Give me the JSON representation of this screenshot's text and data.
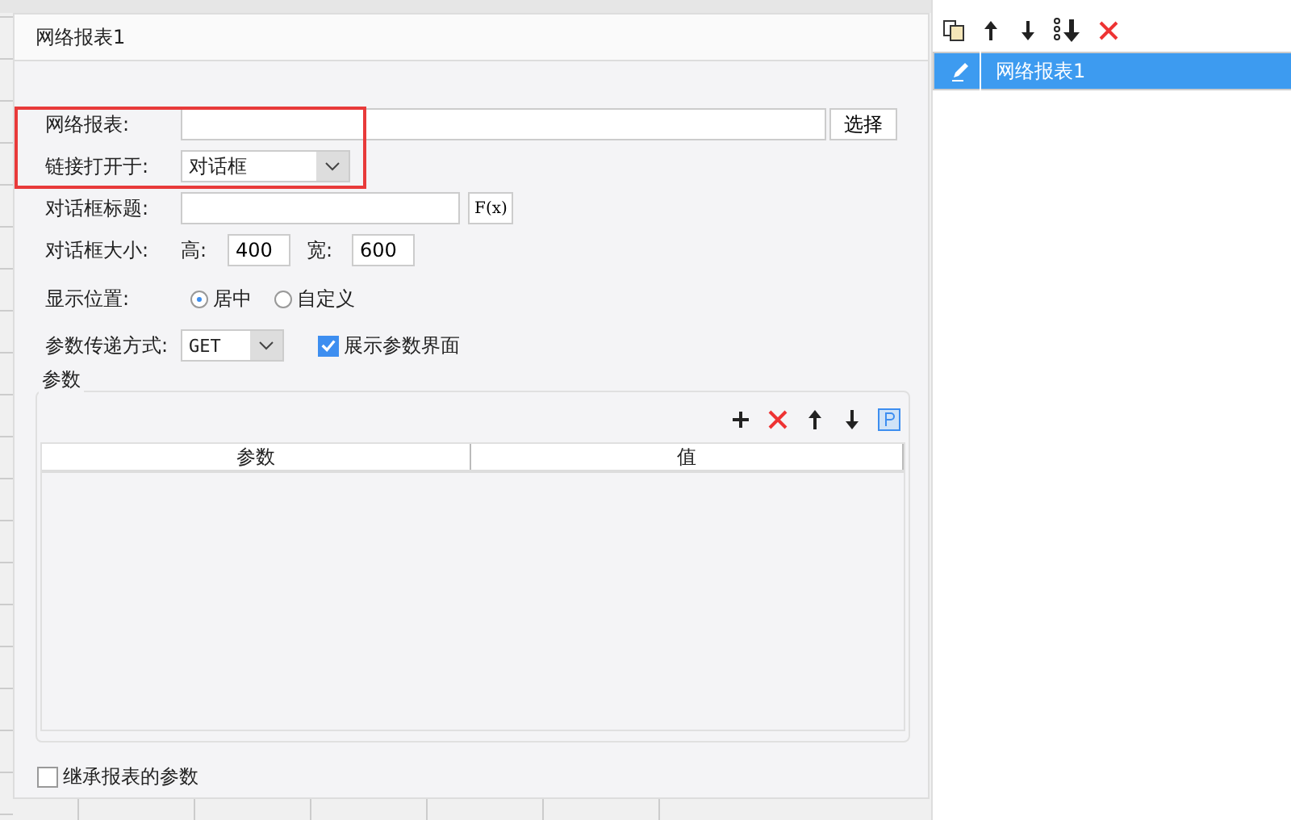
{
  "dialog": {
    "title": "网络报表1"
  },
  "form": {
    "report_label": "网络报表:",
    "choose_button": "选择",
    "open_in_label": "链接打开于:",
    "open_in_value": "对话框",
    "dialog_title_label": "对话框标题:",
    "formula_button": "F(x)",
    "size_label": "对话框大小:",
    "height_label": "高:",
    "height_value": "400",
    "width_label": "宽:",
    "width_value": "600",
    "position_label": "显示位置:",
    "positions": [
      {
        "label": "居中",
        "selected": true
      },
      {
        "label": "自定义",
        "selected": false
      }
    ],
    "method_label": "参数传递方式:",
    "method_value": "GET",
    "show_params": {
      "label": "展示参数界面",
      "checked": true
    }
  },
  "params": {
    "legend": "参数",
    "columns": [
      "参数",
      "值"
    ]
  },
  "inherit": {
    "label": "继承报表的参数",
    "checked": false
  },
  "highlight": true,
  "hyperlinks": {
    "items": [
      {
        "label": "网络报表1",
        "selected": true
      }
    ]
  }
}
